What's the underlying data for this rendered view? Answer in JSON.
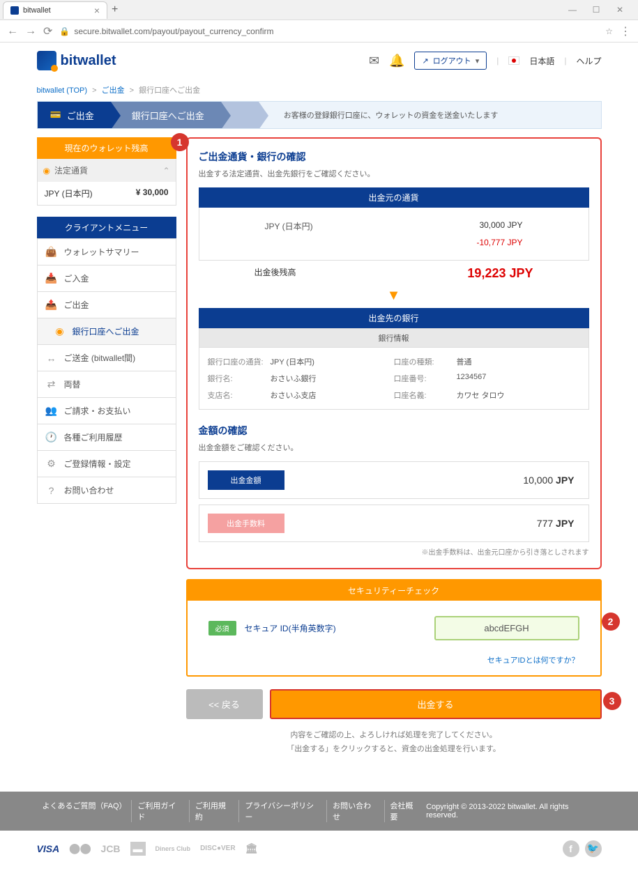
{
  "browser": {
    "tab_title": "bitwallet",
    "url": "secure.bitwallet.com/payout/payout_currency_confirm"
  },
  "header": {
    "brand": "bitwallet",
    "logout": "ログアウト",
    "language": "日本語",
    "help": "ヘルプ"
  },
  "breadcrumb": {
    "home": "bitwallet (TOP)",
    "sep": ">",
    "mid": "ご出金",
    "current": "銀行口座へご出金"
  },
  "stepbar": {
    "step1": "ご出金",
    "step2": "銀行口座へご出金",
    "desc": "お客様の登録銀行口座に、ウォレットの資金を送金いたします"
  },
  "sidebar": {
    "balance_header": "現在のウォレット残高",
    "fiat_label": "法定通貨",
    "balance_cur": "JPY (日本円)",
    "balance_val": "¥ 30,000",
    "menu_header": "クライアントメニュー",
    "items": [
      {
        "label": "ウォレットサマリー"
      },
      {
        "label": "ご入金"
      },
      {
        "label": "ご出金"
      },
      {
        "label": "銀行口座へご出金"
      },
      {
        "label": "ご送金 (bitwallet間)"
      },
      {
        "label": "両替"
      },
      {
        "label": "ご請求・お支払い"
      },
      {
        "label": "各種ご利用履歴"
      },
      {
        "label": "ご登録情報・設定"
      },
      {
        "label": "お問い合わせ"
      }
    ]
  },
  "main": {
    "title1": "ご出金通貨・銀行の確認",
    "desc1": "出金する法定通貨、出金先銀行をご確認ください。",
    "src_header": "出金元の通貨",
    "src_cur": "JPY (日本円)",
    "src_amount": "30,000 JPY",
    "src_fee": "-10,777 JPY",
    "after_label": "出金後残高",
    "after_amount": "19,223 JPY",
    "dest_header": "出金先の銀行",
    "bank_info_header": "銀行情報",
    "bank": {
      "k1": "銀行口座の通貨:",
      "v1": "JPY (日本円)",
      "k2": "口座の種類:",
      "v2": "普通",
      "k3": "銀行名:",
      "v3": "おさいふ銀行",
      "k4": "口座番号:",
      "v4": "1234567",
      "k5": "支店名:",
      "v5": "おさいふ支店",
      "k6": "口座名義:",
      "v6": "カワセ タロウ"
    },
    "title2": "金額の確認",
    "desc2": "出金金額をご確認ください。",
    "amt_label": "出金金額",
    "amt_val": "10,000",
    "amt_unit": "JPY",
    "fee_label": "出金手数料",
    "fee_val": "777",
    "fee_unit": "JPY",
    "fee_note": "※出金手数料は、出金元口座から引き落としされます"
  },
  "security": {
    "header": "セキュリティーチェック",
    "required": "必須",
    "label": "セキュア ID(半角英数字)",
    "value": "abcdEFGH",
    "link": "セキュアIDとは何ですか？"
  },
  "buttons": {
    "back": "<< 戻る",
    "submit": "出金する"
  },
  "footnote": {
    "l1": "内容をご確認の上、よろしければ処理を完了してください。",
    "l2": "「出金する」をクリックすると、資金の出金処理を行います。"
  },
  "footer": {
    "links": [
      "よくあるご質問（FAQ）",
      "ご利用ガイド",
      "ご利用規約",
      "プライバシーポリシー",
      "お問い合わせ",
      "会社概要"
    ],
    "copyright": "Copyright © 2013-2022 bitwallet. All rights reserved."
  },
  "callouts": {
    "c1": "1",
    "c2": "2",
    "c3": "3"
  }
}
